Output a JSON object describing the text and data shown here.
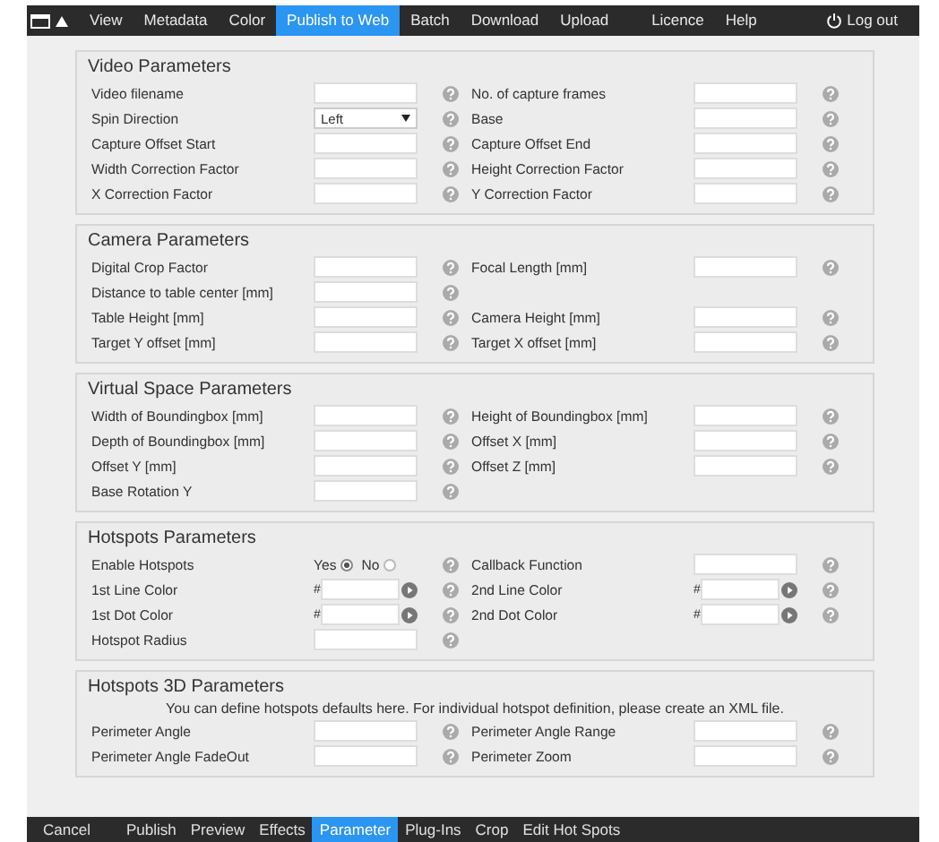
{
  "top_menu": {
    "items": [
      {
        "label": "View",
        "selected": false
      },
      {
        "label": "Metadata",
        "selected": false
      },
      {
        "label": "Color",
        "selected": false
      },
      {
        "label": "Publish to Web",
        "selected": true
      },
      {
        "label": "Batch",
        "selected": false
      },
      {
        "label": "Download",
        "selected": false
      },
      {
        "label": "Upload",
        "selected": false
      },
      {
        "label": "Licence",
        "selected": false
      },
      {
        "label": "Help",
        "selected": false
      }
    ],
    "logout": "Log out"
  },
  "sections": [
    {
      "title": "Video Parameters",
      "rows": [
        {
          "left": {
            "label": "Video filename",
            "kind": "text"
          },
          "right": {
            "label": "No. of capture frames",
            "kind": "text"
          }
        },
        {
          "left": {
            "label": "Spin Direction",
            "kind": "select",
            "value": "Left"
          },
          "right": {
            "label": "Base",
            "kind": "text"
          }
        },
        {
          "left": {
            "label": "Capture Offset Start",
            "kind": "text"
          },
          "right": {
            "label": "Capture Offset End",
            "kind": "text"
          }
        },
        {
          "left": {
            "label": "Width Correction Factor",
            "kind": "text"
          },
          "right": {
            "label": "Height Correction Factor",
            "kind": "text"
          }
        },
        {
          "left": {
            "label": "X Correction Factor",
            "kind": "text"
          },
          "right": {
            "label": "Y Correction Factor",
            "kind": "text"
          }
        }
      ]
    },
    {
      "title": "Camera Parameters",
      "rows": [
        {
          "left": {
            "label": "Digital Crop Factor",
            "kind": "text"
          },
          "right": {
            "label": "Focal Length [mm]",
            "kind": "text"
          }
        },
        {
          "left": {
            "label": "Distance to table center [mm]",
            "kind": "text"
          }
        },
        {
          "left": {
            "label": "Table Height [mm]",
            "kind": "text"
          },
          "right": {
            "label": "Camera Height [mm]",
            "kind": "text"
          }
        },
        {
          "left": {
            "label": "Target Y offset [mm]",
            "kind": "text"
          },
          "right": {
            "label": "Target X offset [mm]",
            "kind": "text"
          }
        }
      ]
    },
    {
      "title": "Virtual Space Parameters",
      "rows": [
        {
          "left": {
            "label": "Width of Boundingbox [mm]",
            "kind": "text"
          },
          "right": {
            "label": "Height of Boundingbox [mm]",
            "kind": "text"
          }
        },
        {
          "left": {
            "label": "Depth of Boundingbox [mm]",
            "kind": "text"
          },
          "right": {
            "label": "Offset X [mm]",
            "kind": "text"
          }
        },
        {
          "left": {
            "label": "Offset Y [mm]",
            "kind": "text"
          },
          "right": {
            "label": "Offset Z [mm]",
            "kind": "text"
          }
        },
        {
          "left": {
            "label": "Base Rotation Y",
            "kind": "text"
          }
        }
      ]
    },
    {
      "title": "Hotspots Parameters",
      "rows": [
        {
          "left": {
            "label": "Enable Hotspots",
            "kind": "radio",
            "options": [
              {
                "label": "Yes",
                "selected": true
              },
              {
                "label": "No",
                "selected": false
              }
            ]
          },
          "right": {
            "label": "Callback Function",
            "kind": "text"
          }
        },
        {
          "left": {
            "label": "1st Line Color",
            "kind": "color",
            "prefix": "#"
          },
          "right": {
            "label": "2nd Line Color",
            "kind": "color",
            "prefix": "#"
          }
        },
        {
          "left": {
            "label": "1st Dot Color",
            "kind": "color",
            "prefix": "#"
          },
          "right": {
            "label": "2nd Dot Color",
            "kind": "color",
            "prefix": "#"
          }
        },
        {
          "left": {
            "label": "Hotspot Radius",
            "kind": "text"
          }
        }
      ]
    },
    {
      "title": "Hotspots 3D Parameters",
      "note": "You can define hotspots defaults here. For individual hotspot definition, please create an XML file.",
      "rows": [
        {
          "left": {
            "label": "Perimeter Angle",
            "kind": "text"
          },
          "right": {
            "label": "Perimeter Angle Range",
            "kind": "text"
          }
        },
        {
          "left": {
            "label": "Perimeter Angle FadeOut",
            "kind": "text"
          },
          "right": {
            "label": "Perimeter Zoom",
            "kind": "text"
          }
        }
      ]
    }
  ],
  "bottom_menu": {
    "items": [
      {
        "label": "Cancel",
        "selected": false
      },
      {
        "label": "Publish",
        "selected": false
      },
      {
        "label": "Preview",
        "selected": false
      },
      {
        "label": "Effects",
        "selected": false
      },
      {
        "label": "Parameter",
        "selected": true
      },
      {
        "label": "Plug-Ins",
        "selected": false
      },
      {
        "label": "Crop",
        "selected": false
      },
      {
        "label": "Edit Hot Spots",
        "selected": false
      }
    ]
  }
}
